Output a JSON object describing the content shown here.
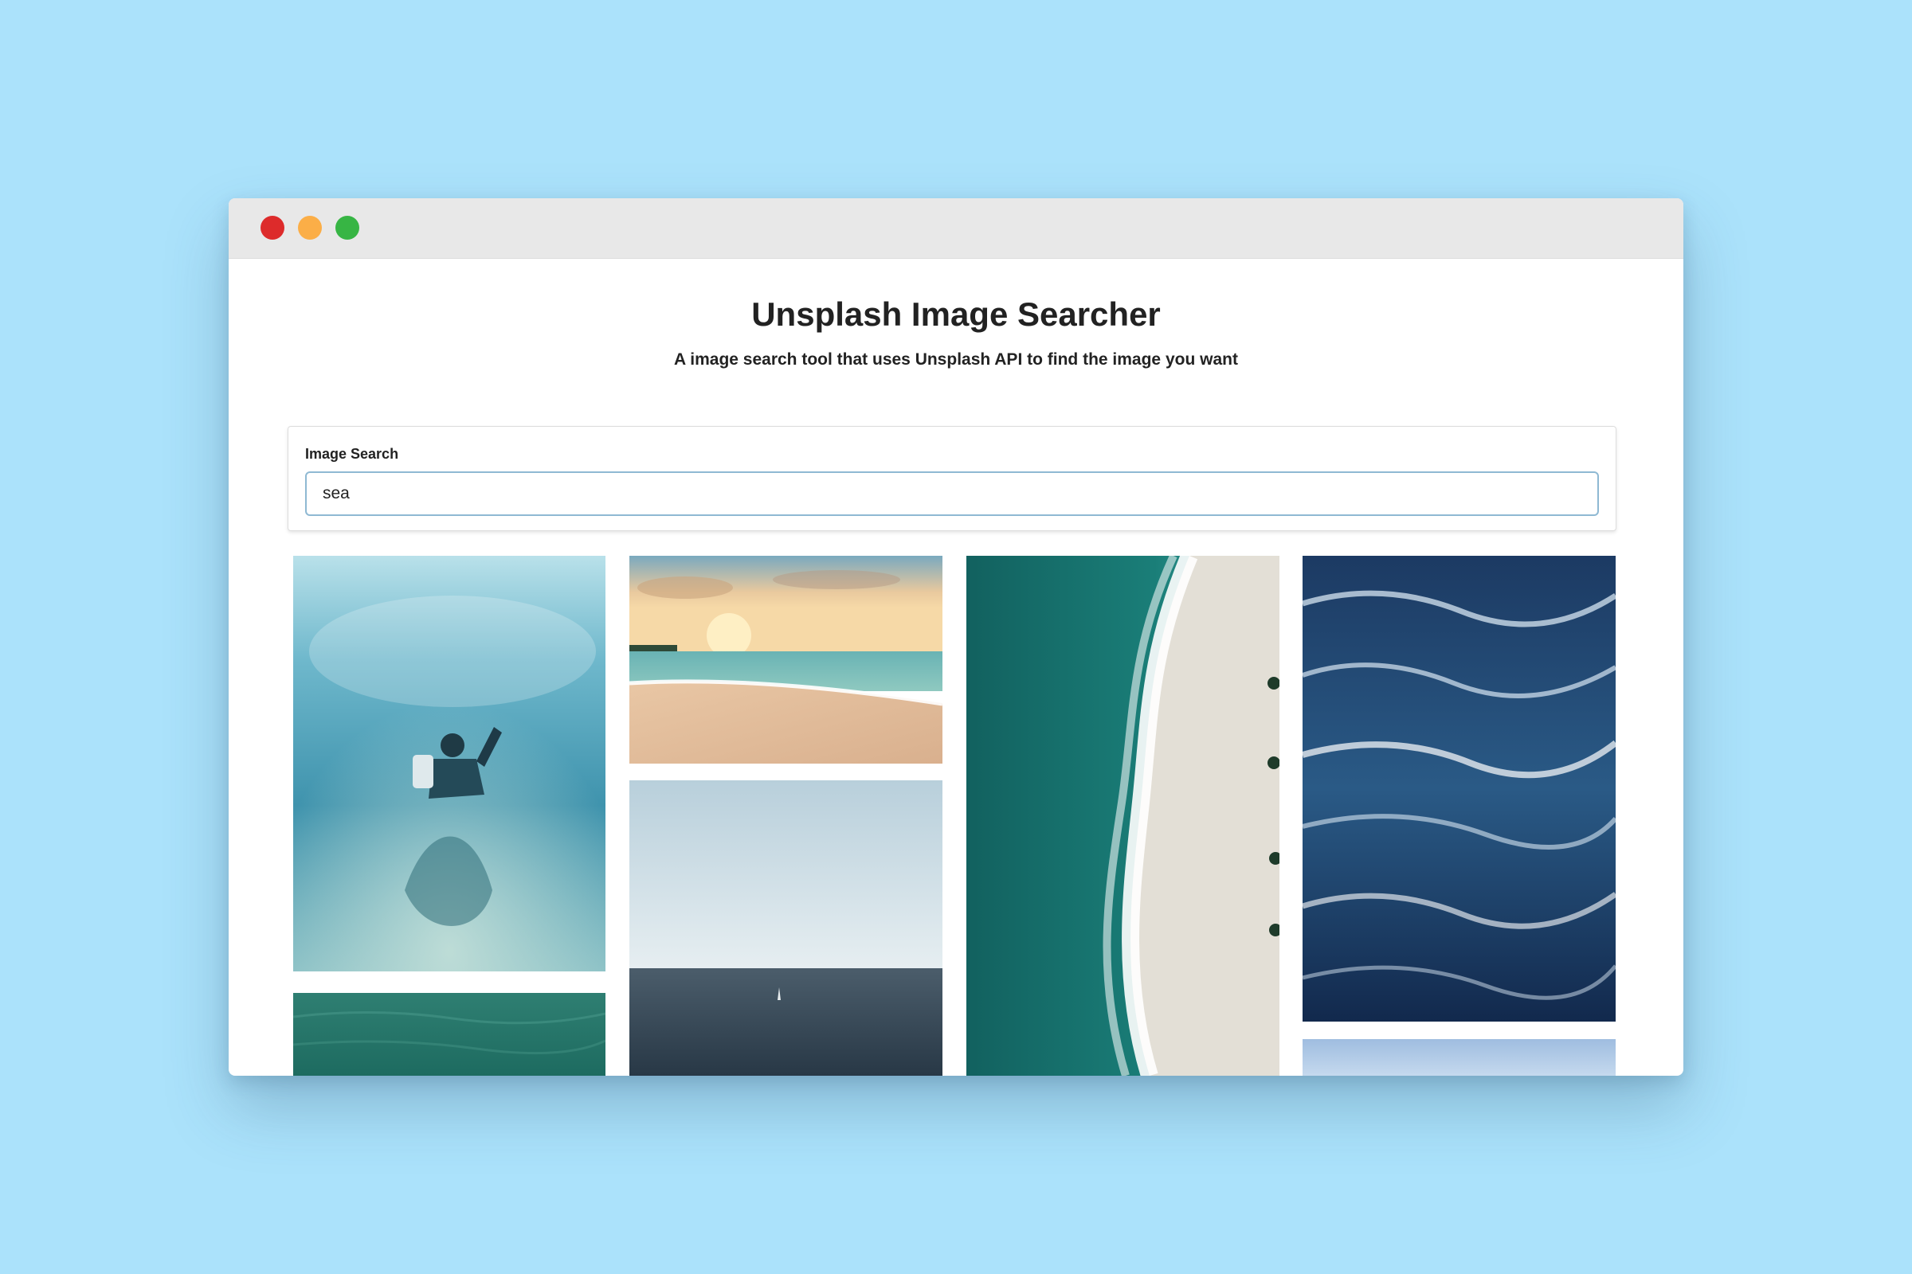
{
  "window": {
    "controls": {
      "close_color": "#dd2b2b",
      "minimize_color": "#fbae47",
      "zoom_color": "#37b544"
    }
  },
  "header": {
    "title": "Unsplash Image Searcher",
    "subtitle": "A image search tool that uses Unsplash API to find the image you want"
  },
  "search": {
    "label": "Image Search",
    "value": "sea"
  },
  "results": [
    {
      "id": "underwater-diver-photo",
      "icon": "underwater-diver-image"
    },
    {
      "id": "green-water-photo",
      "icon": "green-water-image"
    },
    {
      "id": "beach-sunset-photo",
      "icon": "beach-sunset-image"
    },
    {
      "id": "ocean-horizon-sailboat-photo",
      "icon": "sailboat-horizon-image"
    },
    {
      "id": "aerial-beach-waves-photo",
      "icon": "aerial-shoreline-image"
    },
    {
      "id": "deep-ocean-waves-photo",
      "icon": "ocean-waves-image"
    },
    {
      "id": "sky-photo",
      "icon": "sky-image"
    }
  ]
}
